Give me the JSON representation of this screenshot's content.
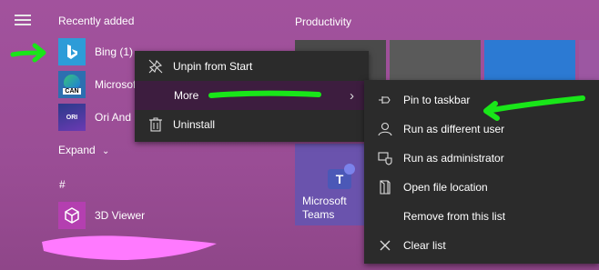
{
  "start_menu": {
    "recently_added_header": "Recently added",
    "productivity_header": "Productivity",
    "expand_label": "Expand",
    "hash_header": "#",
    "apps": [
      {
        "label": "Bing (1)",
        "icon": "bing-icon"
      },
      {
        "label": "Microsoft",
        "icon": "edge-can-icon",
        "badge": "CAN"
      },
      {
        "label": "Ori And",
        "icon": "ori-icon",
        "badge": "ORI"
      },
      {
        "label": "3D Viewer",
        "icon": "3d-viewer-icon"
      }
    ],
    "teams_tile": {
      "label_line1": "Microsoft",
      "label_line2": "Teams",
      "icon_letter": "T"
    }
  },
  "context_menu": {
    "items": [
      {
        "label": "Unpin from Start",
        "icon": "unpin-icon"
      },
      {
        "label": "More",
        "icon": "chevron-right-icon"
      },
      {
        "label": "Uninstall",
        "icon": "trash-icon"
      }
    ]
  },
  "submenu": {
    "items": [
      {
        "label": "Pin to taskbar",
        "icon": "pin-icon"
      },
      {
        "label": "Run as different user",
        "icon": "user-icon"
      },
      {
        "label": "Run as administrator",
        "icon": "shield-icon"
      },
      {
        "label": "Open file location",
        "icon": "folder-icon"
      },
      {
        "label": "Remove from this list",
        "icon": ""
      },
      {
        "label": "Clear list",
        "icon": "close-icon"
      }
    ]
  },
  "colors": {
    "background": "#9a4f96",
    "menu": "#2b2b2b",
    "highlight": "#3d1d3f",
    "annotation_green": "#19e619",
    "annotation_pink": "#ff7aff"
  }
}
